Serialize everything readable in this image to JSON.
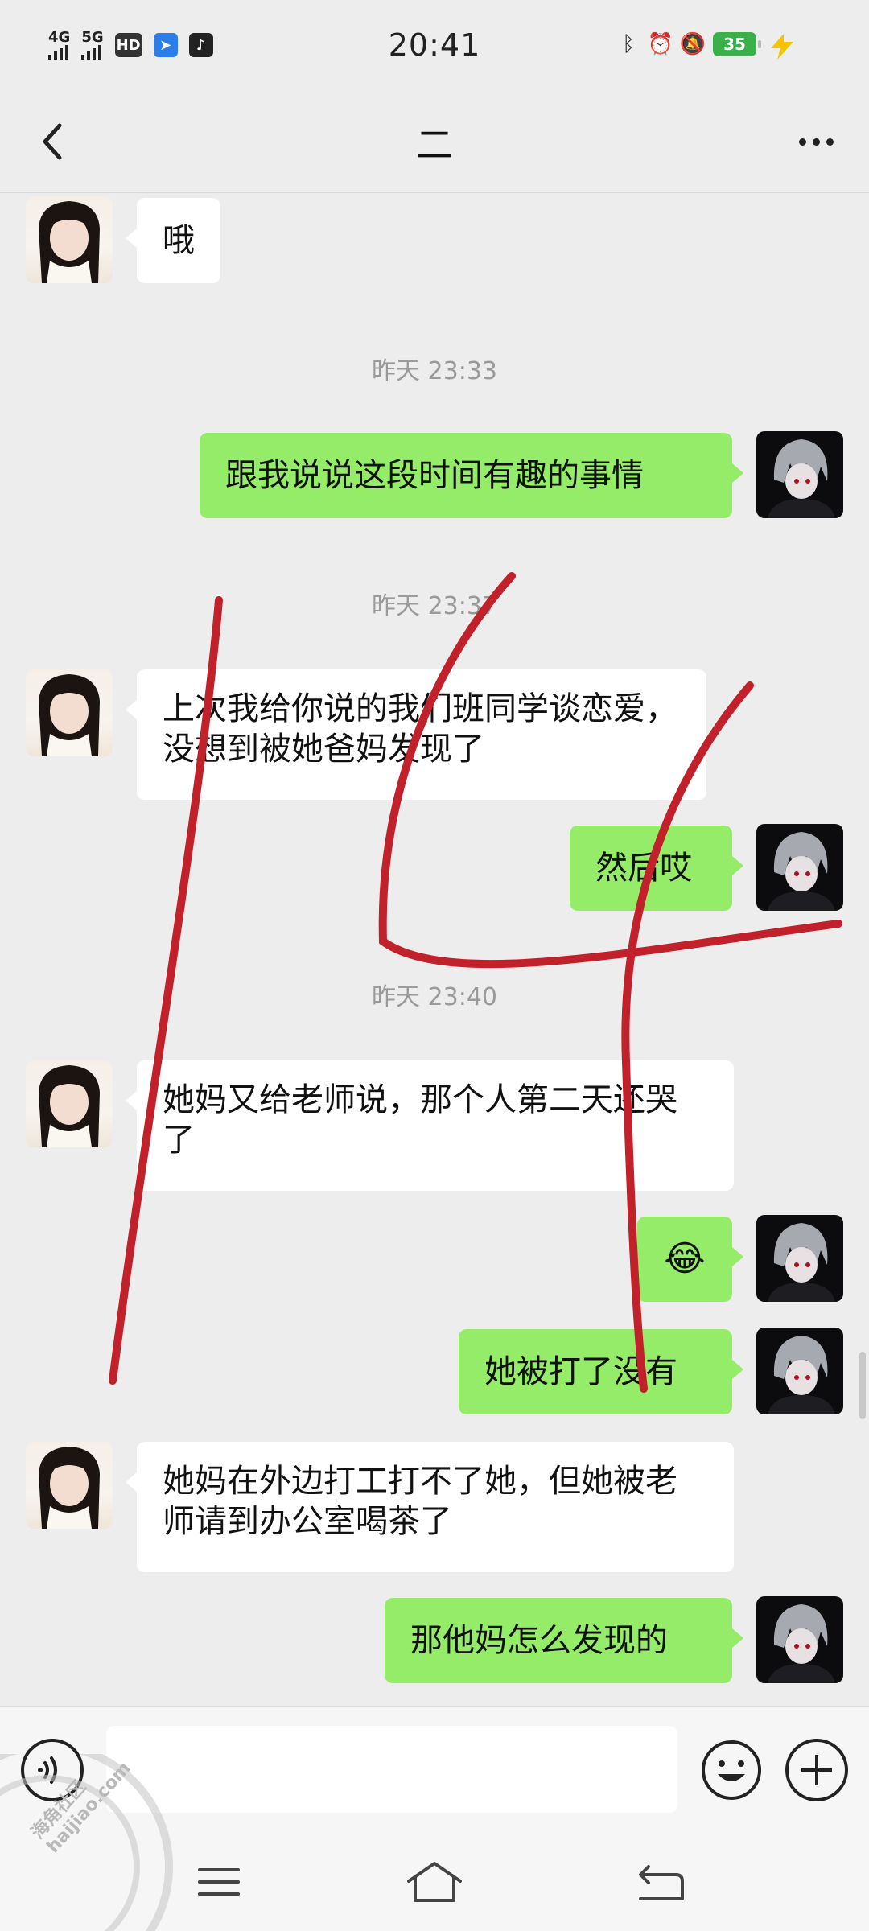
{
  "status_bar": {
    "network_1": "4G",
    "network_2": "5G",
    "hd_badge": "HD",
    "time": "20:41",
    "battery": "35"
  },
  "header": {
    "title": "二",
    "back_icon": "chevron-left-icon",
    "more_icon": "more-dots-icon"
  },
  "messages": [
    {
      "type": "message",
      "side": "in",
      "text": "哦"
    },
    {
      "type": "timestamp",
      "text": "昨天 23:33"
    },
    {
      "type": "message",
      "side": "out",
      "text": "跟我说说这段时间有趣的事情"
    },
    {
      "type": "timestamp",
      "text": "昨天 23:37"
    },
    {
      "type": "message",
      "side": "in",
      "text": "上次我给你说的我们班同学谈恋爱，没想到被她爸妈发现了"
    },
    {
      "type": "message",
      "side": "out",
      "text": "然后哎"
    },
    {
      "type": "timestamp",
      "text": "昨天 23:40"
    },
    {
      "type": "message",
      "side": "in",
      "text": "她妈又给老师说，那个人第二天还哭了"
    },
    {
      "type": "message",
      "side": "out",
      "text": "😂"
    },
    {
      "type": "message",
      "side": "out",
      "text": "她被打了没有"
    },
    {
      "type": "message",
      "side": "in",
      "text": "她妈在外边打工打不了她，但她被老师请到办公室喝茶了"
    },
    {
      "type": "message",
      "side": "out",
      "text": "那他妈怎么发现的"
    }
  ],
  "input_bar": {
    "voice_icon": "voice-icon",
    "emoji_icon": "emoji-icon",
    "plus_icon": "plus-icon"
  },
  "watermark": {
    "line1": "海角社区",
    "line2": "haijiao.com"
  },
  "colors": {
    "background": "#ededed",
    "outgoing_bubble": "#95ec69",
    "incoming_bubble": "#ffffff",
    "timestamp": "#9a9a9a",
    "scribble": "#c0212b"
  }
}
